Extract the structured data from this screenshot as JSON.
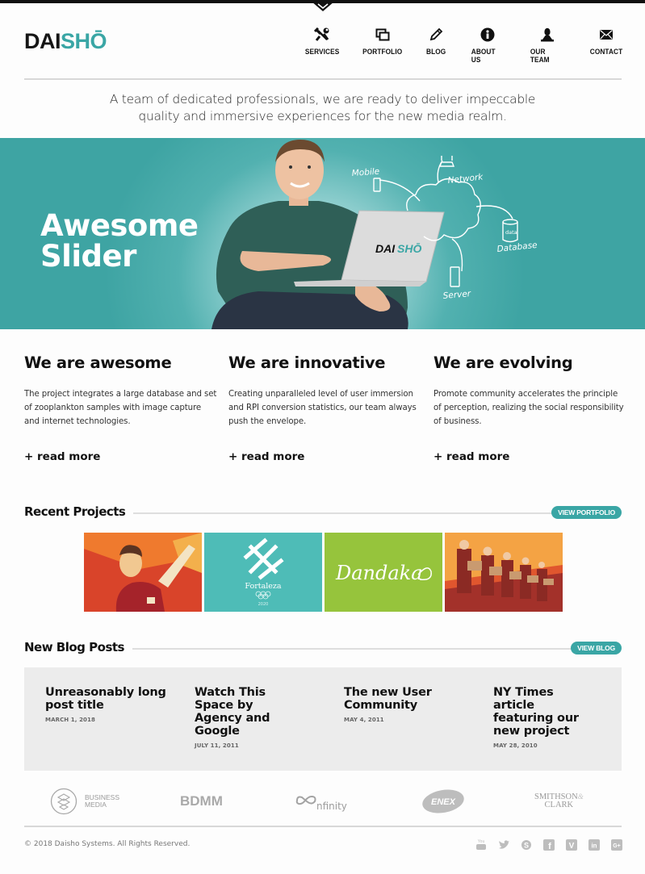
{
  "brand": {
    "logo_dark": "DAI",
    "logo_accent": "SHŌ",
    "accent_color": "#3aa6a5"
  },
  "nav": {
    "items": [
      {
        "label": "SERVICES",
        "icon": "tools-icon"
      },
      {
        "label": "PORTFOLIO",
        "icon": "windows-icon"
      },
      {
        "label": "BLOG",
        "icon": "pencil-icon"
      },
      {
        "label": "ABOUT US",
        "icon": "info-icon"
      },
      {
        "label": "OUR TEAM",
        "icon": "user-icon"
      },
      {
        "label": "CONTACT",
        "icon": "envelope-icon"
      }
    ]
  },
  "tagline": {
    "line1": "A team of dedicated professionals, we are ready to deliver impeccable",
    "line2": "quality and immersive experiences for the new media realm."
  },
  "hero": {
    "title_line1": "Awesome",
    "title_line2": "Slider",
    "laptop_logo_dark": "DAI",
    "laptop_logo_accent": "SHŌ",
    "diagram_labels": {
      "mobile": "Mobile",
      "network": "Network",
      "database": "Database",
      "data": "data",
      "server": "Server"
    }
  },
  "features": [
    {
      "title": "We are awesome",
      "text": "The project integrates a large database and set of zooplankton samples with image capture and internet technologies.",
      "link": "+ read more"
    },
    {
      "title": "We are innovative",
      "text": "Creating unparalleled level of user immersion and RPI conversion statistics, our team always push the envelope.",
      "link": "+ read more"
    },
    {
      "title": "We are evolving",
      "text": "Promote community accelerates the principle of perception, realizing the social responsibility of business.",
      "link": "+ read more"
    }
  ],
  "recent_projects": {
    "title": "Recent Projects",
    "button": "VIEW PORTFOLIO",
    "items": [
      {
        "name": "Retro poster illustration"
      },
      {
        "name": "Fortaleza",
        "caption": "Fortaleza",
        "year": "2020"
      },
      {
        "name": "Dandaka",
        "caption": "Dandaka"
      },
      {
        "name": "Marching workers illustration"
      }
    ]
  },
  "blog": {
    "title": "New Blog Posts",
    "button": "VIEW BLOG",
    "posts": [
      {
        "title": "Unreasonably long post title",
        "date": "MARCH 1, 2018"
      },
      {
        "title": "Watch This Space by Agency and Google",
        "date": "JULY 11, 2011"
      },
      {
        "title": "The new User Community",
        "date": "MAY 4, 2011"
      },
      {
        "title": "NY Times article featuring our new project",
        "date": "MAY 28, 2010"
      }
    ]
  },
  "partners": {
    "business_media_1": "BUSINESS",
    "business_media_2": "MEDIA",
    "bdmm": "BDMM",
    "infinity": "nfinity",
    "enex": "ENEX",
    "smithson_1": "SMITHSON",
    "smithson_amp": "&",
    "smithson_2": "CLARK"
  },
  "footer": {
    "copyright": "© 2018 Daisho Systems. All Rights Reserved.",
    "socials": [
      "youtube",
      "twitter",
      "skype",
      "facebook",
      "vimeo",
      "linkedin",
      "google-plus"
    ],
    "social_glyphs": {
      "youtube": "You",
      "facebook": "f",
      "vimeo": "V",
      "linkedin": "in",
      "google_plus": "G+",
      "skype": "S"
    }
  }
}
